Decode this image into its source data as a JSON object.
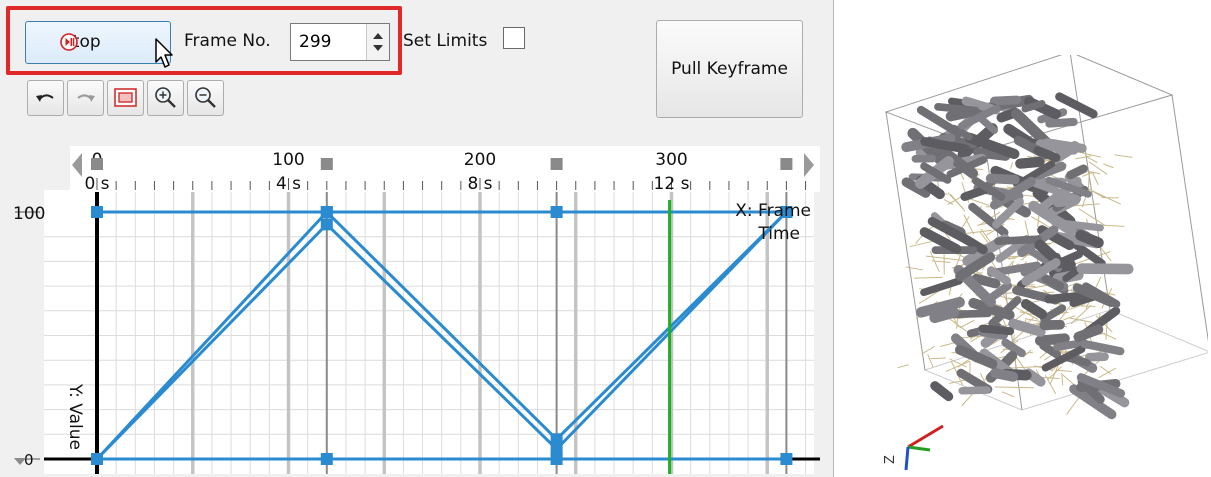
{
  "controls": {
    "stop_label": "Stop",
    "frame_label": "Frame No.",
    "frame_value": "299",
    "set_limits_label": "Set Limits",
    "pull_keyframe_label": "Pull Keyframe"
  },
  "ruler": {
    "frames": [
      "0",
      "100",
      "200",
      "300"
    ],
    "times": [
      "0 s",
      "4 s",
      "8 s",
      "12 s"
    ]
  },
  "axes": {
    "x_label": "X: Frame",
    "x_label2": "Time",
    "y_label": "Y: Value",
    "y_top": "100",
    "y_bottom": "0"
  },
  "chart_data": {
    "type": "line",
    "current_frame": 299,
    "keyframes_x": [
      0,
      120,
      240,
      360
    ],
    "series": [
      {
        "x": [
          0,
          120,
          240,
          360
        ],
        "y": [
          0,
          95,
          4,
          100
        ]
      },
      {
        "x": [
          0,
          120,
          240,
          360
        ],
        "y": [
          0,
          100,
          8,
          100
        ]
      },
      {
        "x": [
          0,
          120,
          240,
          360
        ],
        "y": [
          100,
          100,
          100,
          100
        ]
      },
      {
        "x": [
          0,
          120,
          240,
          360
        ],
        "y": [
          0,
          0,
          0,
          0
        ]
      }
    ],
    "xlim": [
      0,
      372
    ],
    "ylim": [
      0,
      100
    ],
    "colors": {
      "line": "#2a8bd0",
      "current_frame": "#1fb020",
      "axis": "#000000",
      "grid": "#dcdcdc"
    }
  }
}
